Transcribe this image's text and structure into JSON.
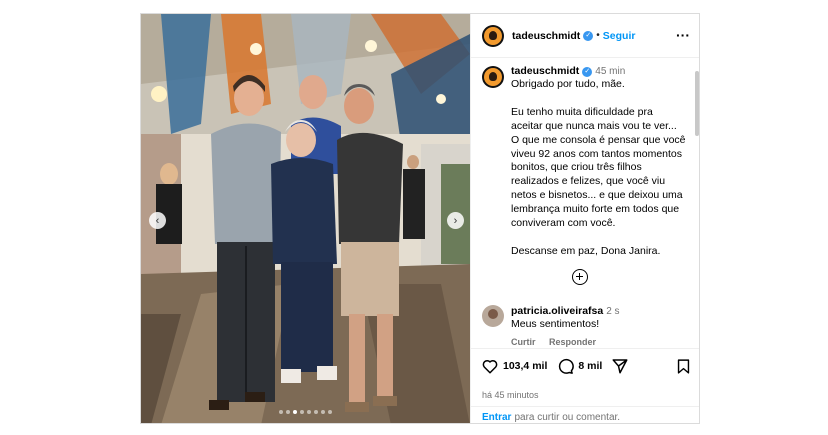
{
  "post": {
    "username": "tadeuschmidt",
    "follow_label": "Seguir",
    "more_icon": "more-horizontal-icon"
  },
  "caption": {
    "username": "tadeuschmidt",
    "time": "45 min",
    "text": "Obrigado por tudo, mãe.\n\nEu tenho muita dificuldade pra aceitar que nunca mais vou te ver... O que me consola é pensar que você viveu 92 anos com tantos momentos bonitos, que criou três filhos realizados e felizes, que você viu netos e bisnetos... e que deixou uma lembrança muito forte em todos que conviveram com você.\n\nDescanse em paz, Dona Janira."
  },
  "comment": {
    "username": "patricia.oliveirafsa",
    "time": "2 s",
    "text": "Meus sentimentos!",
    "reply_like": "Curtir",
    "reply": "Responder"
  },
  "stats": {
    "likes": "103,4 mil",
    "comments": "8 mil",
    "ago": "há 45 minutos"
  },
  "login": {
    "enter": "Entrar",
    "rest": "para curtir ou comentar."
  },
  "carousel": {
    "count": 8,
    "active_index": 2
  },
  "colors": {
    "link": "#0095f6",
    "verified": "#3897f0",
    "muted": "#737373",
    "border": "#dbdbdb"
  }
}
